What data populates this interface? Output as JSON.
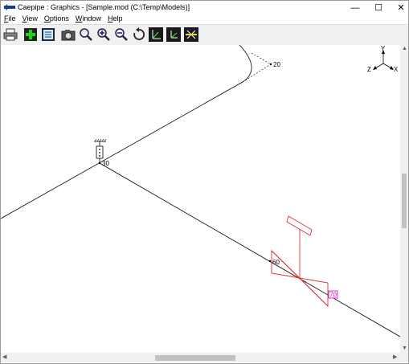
{
  "window": {
    "title": "Caepipe : Graphics - [Sample.mod (C:\\Temp\\Models)]",
    "min_glyph": "—",
    "max_glyph": "☐",
    "close_glyph": "✕"
  },
  "menu": {
    "file": "File",
    "view": "View",
    "options": "Options",
    "window": "Window",
    "help": "Help"
  },
  "toolbar": [
    "print-icon",
    "add-node-icon",
    "list-icon",
    "camera-icon",
    "zoom-icon",
    "zoom-in-icon",
    "zoom-out-icon",
    "rotate-icon",
    "view-xy-icon",
    "view-axis-icon",
    "view-iso-icon"
  ],
  "model": {
    "node_labels": [
      "20",
      "30",
      "60",
      "70"
    ]
  },
  "axis": {
    "y": "Y",
    "z": "Z",
    "x": "X"
  },
  "scroll": {
    "up": "▲",
    "down": "▼",
    "left": "◀",
    "right": "▶"
  },
  "colors": {
    "support": "#e03030",
    "highlight": "#cc00cc"
  }
}
